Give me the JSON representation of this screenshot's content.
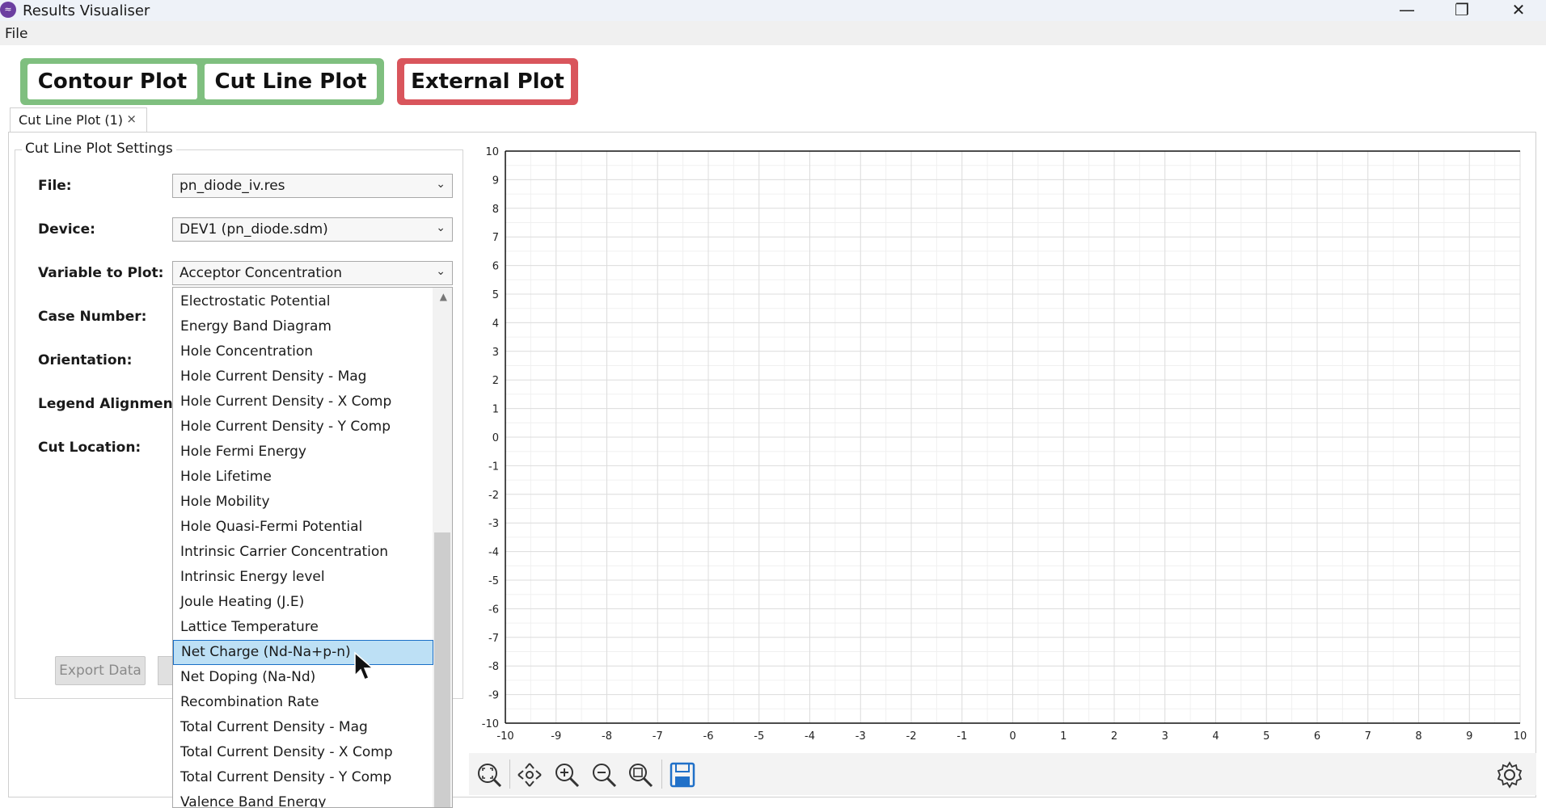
{
  "window": {
    "title": "Results Visualiser",
    "icon": "app-logo-icon"
  },
  "menu": {
    "file": "File"
  },
  "top_buttons": {
    "contour": "Contour Plot",
    "cutline": "Cut Line Plot",
    "external": "External Plot"
  },
  "colors": {
    "green_group": "#7fbf7f",
    "red_group": "#d9555c",
    "selection": "#bde0f5"
  },
  "tab": {
    "label": "Cut Line Plot (1)",
    "close": "×"
  },
  "settings": {
    "group_title": "Cut Line Plot Settings",
    "file_label": "File:",
    "file_value": "pn_diode_iv.res",
    "device_label": "Device:",
    "device_value": "DEV1 (pn_diode.sdm)",
    "variable_label": "Variable to Plot:",
    "variable_value": "Acceptor Concentration",
    "case_label": "Case Number:",
    "orientation_label": "Orientation:",
    "legend_label": "Legend Alignment:",
    "cut_label": "Cut Location:",
    "export_button": "Export Data"
  },
  "dropdown": {
    "items": [
      "Electrostatic Potential",
      "Energy Band Diagram",
      "Hole Concentration",
      "Hole Current Density - Mag",
      "Hole Current Density - X Comp",
      "Hole Current Density - Y Comp",
      "Hole Fermi Energy",
      "Hole Lifetime",
      "Hole Mobility",
      "Hole Quasi-Fermi Potential",
      "Intrinsic Carrier Concentration",
      "Intrinsic Energy level",
      "Joule Heating (J.E)",
      "Lattice Temperature",
      "Net Charge (Nd-Na+p-n)",
      "Net Doping (Na-Nd)",
      "Recombination Rate",
      "Total Current Density - Mag",
      "Total Current Density - X Comp",
      "Total Current Density - Y Comp",
      "Valence Band Energy"
    ],
    "highlighted_index": 14
  },
  "chart_data": {
    "type": "line",
    "series": [],
    "xlim": [
      -10,
      10
    ],
    "ylim": [
      -10,
      10
    ],
    "x_ticks": [
      "-10",
      "-9",
      "-8",
      "-7",
      "-6",
      "-5",
      "-4",
      "-3",
      "-2",
      "-1",
      "0",
      "1",
      "2",
      "3",
      "4",
      "5",
      "6",
      "7",
      "8",
      "9",
      "10"
    ],
    "y_ticks": [
      "10",
      "9",
      "8",
      "7",
      "6",
      "5",
      "4",
      "3",
      "2",
      "1",
      "0",
      "-1",
      "-2",
      "-3",
      "-4",
      "-5",
      "-6",
      "-7",
      "-8",
      "-9",
      "-10"
    ],
    "grid": true,
    "title": "",
    "xlabel": "",
    "ylabel": ""
  },
  "toolbar": {
    "icons": [
      "zoom-fit-icon",
      "pan-icon",
      "zoom-in-icon",
      "zoom-out-icon",
      "zoom-extents-icon",
      "save-icon",
      "settings-gear-icon"
    ]
  }
}
